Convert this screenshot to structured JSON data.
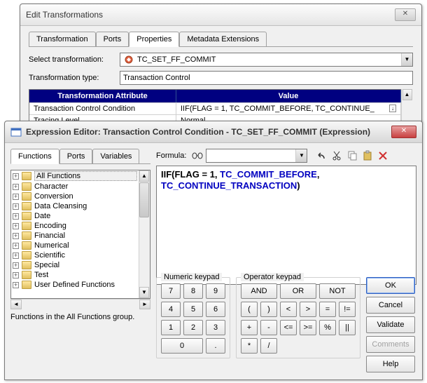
{
  "win1": {
    "title": "Edit Transformations",
    "tabs": [
      "Transformation",
      "Ports",
      "Properties",
      "Metadata Extensions"
    ],
    "select_label": "Select transformation:",
    "select_value": "TC_SET_FF_COMMIT",
    "type_label": "Transformation type:",
    "type_value": "Transaction Control",
    "grid": {
      "header1": "Transformation Attribute",
      "header2": "Value",
      "rows": [
        {
          "attr": "Transaction Control Condition",
          "val": "IIF(FLAG = 1, TC_COMMIT_BEFORE, TC_CONTINUE_"
        },
        {
          "attr": "Tracing Level",
          "val": "Normal"
        }
      ]
    }
  },
  "win2": {
    "title": "Expression Editor: Transaction Control Condition - TC_SET_FF_COMMIT (Expression)",
    "tabs": [
      "Functions",
      "Ports",
      "Variables"
    ],
    "tree": [
      "All Functions",
      "Character",
      "Conversion",
      "Data Cleansing",
      "Date",
      "Encoding",
      "Financial",
      "Numerical",
      "Scientific",
      "Special",
      "Test",
      "User Defined Functions"
    ],
    "status": "Functions in the All Functions group.",
    "formula_label": "Formula:",
    "formula_plain": "IIF(FLAG = 1, ",
    "formula_fn1": "TC_COMMIT_BEFORE",
    "formula_sep": ", ",
    "formula_fn2": "TC_CONTINUE_TRANSACTION",
    "formula_end": ")",
    "numpad_label": "Numeric keypad",
    "numpad": [
      "7",
      "8",
      "9",
      "4",
      "5",
      "6",
      "1",
      "2",
      "3",
      "0",
      "."
    ],
    "oppad_label": "Operator keypad",
    "oppad_row1": [
      "AND",
      "OR",
      "NOT"
    ],
    "oppad_rest": [
      "(",
      ")",
      "<",
      ">",
      "=",
      "!=",
      "+",
      "-",
      "<=",
      ">=",
      "%",
      "||",
      "*",
      "/"
    ],
    "buttons": {
      "ok": "OK",
      "cancel": "Cancel",
      "validate": "Validate",
      "comments": "Comments",
      "help": "Help"
    }
  }
}
